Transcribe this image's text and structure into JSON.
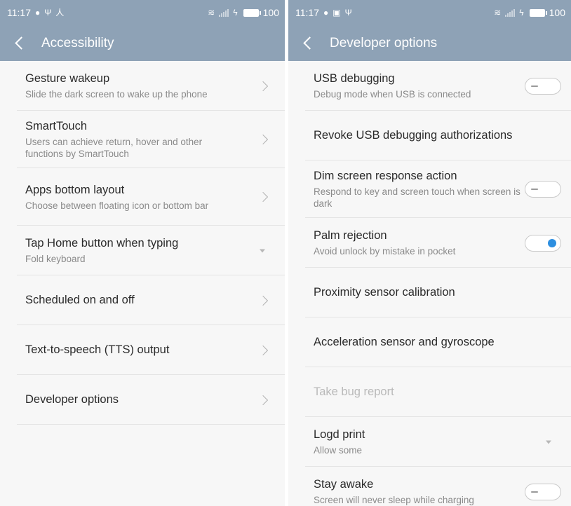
{
  "left": {
    "status": {
      "time": "11:17",
      "battery": "100"
    },
    "title": "Accessibility",
    "items": [
      {
        "title": "Gesture wakeup",
        "subtitle": "Slide the dark screen to wake up the phone"
      },
      {
        "title": "SmartTouch",
        "subtitle": "Users can achieve return, hover and other functions by SmartTouch"
      },
      {
        "title": "Apps bottom layout",
        "subtitle": "Choose between floating icon or bottom bar"
      },
      {
        "title": "Tap Home button when typing",
        "subtitle": "Fold keyboard"
      },
      {
        "title": "Scheduled on and off"
      },
      {
        "title": "Text-to-speech (TTS) output"
      },
      {
        "title": "Developer options"
      }
    ]
  },
  "right": {
    "status": {
      "time": "11:17",
      "battery": "100"
    },
    "title": "Developer options",
    "items": [
      {
        "title": "USB debugging",
        "subtitle": "Debug mode when USB is connected",
        "toggle": false
      },
      {
        "title": "Revoke USB debugging authorizations"
      },
      {
        "title": "Dim screen response action",
        "subtitle": "Respond to key and screen touch when screen is dark",
        "toggle": false
      },
      {
        "title": "Palm rejection",
        "subtitle": "Avoid unlock by mistake in pocket",
        "toggle": true
      },
      {
        "title": "Proximity sensor calibration"
      },
      {
        "title": "Acceleration sensor and gyroscope"
      },
      {
        "title": "Take bug report",
        "disabled": true
      },
      {
        "title": "Logd print",
        "subtitle": "Allow some"
      },
      {
        "title": "Stay awake",
        "subtitle": "Screen will never sleep while charging",
        "toggle": false
      }
    ]
  },
  "colors": {
    "header": "#8ea2b6",
    "accent": "#2d8fe0"
  }
}
